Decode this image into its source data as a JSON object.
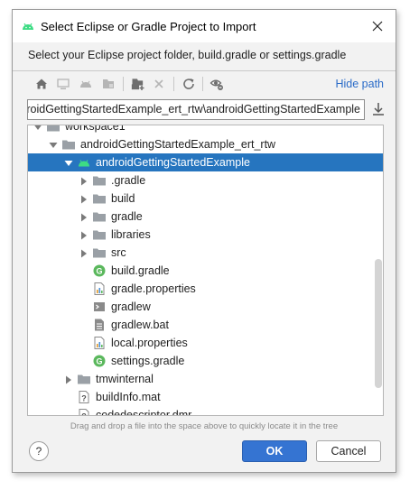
{
  "window": {
    "title": "Select Eclipse or Gradle Project to Import",
    "subtitle": "Select your Eclipse project folder, build.gradle or settings.gradle"
  },
  "toolbar": {
    "hide_path_label": "Hide path"
  },
  "path": {
    "value": "ndroidGettingStartedExample_ert_rtw\\androidGettingStartedExample"
  },
  "tree": {
    "rows": [
      {
        "label": "workspace1",
        "icon": "folder-icon",
        "expanded": true
      },
      {
        "label": "androidGettingStartedExample_ert_rtw",
        "icon": "folder-icon",
        "expanded": true
      },
      {
        "label": "androidGettingStartedExample",
        "icon": "android-icon",
        "expanded": true,
        "selected": true
      },
      {
        "label": ".gradle",
        "icon": "folder-icon",
        "expanded": false
      },
      {
        "label": "build",
        "icon": "folder-icon",
        "expanded": false
      },
      {
        "label": "gradle",
        "icon": "folder-icon",
        "expanded": false
      },
      {
        "label": "libraries",
        "icon": "folder-icon",
        "expanded": false
      },
      {
        "label": "src",
        "icon": "folder-icon",
        "expanded": false
      },
      {
        "label": "build.gradle",
        "icon": "gradle-file-icon"
      },
      {
        "label": "gradle.properties",
        "icon": "properties-file-icon"
      },
      {
        "label": "gradlew",
        "icon": "shell-file-icon"
      },
      {
        "label": "gradlew.bat",
        "icon": "text-file-icon"
      },
      {
        "label": "local.properties",
        "icon": "properties-file-icon"
      },
      {
        "label": "settings.gradle",
        "icon": "gradle-file-icon"
      },
      {
        "label": "tmwinternal",
        "icon": "folder-icon",
        "expanded": false
      },
      {
        "label": "buildInfo.mat",
        "icon": "unknown-file-icon"
      },
      {
        "label": "codedescriptor.dmr",
        "icon": "unknown-file-icon"
      }
    ]
  },
  "hint": "Drag and drop a file into the space above to quickly locate it in the tree",
  "buttons": {
    "help": "?",
    "ok": "OK",
    "cancel": "Cancel"
  },
  "colors": {
    "selection": "#2675bf",
    "link": "#2a6bc8",
    "ok_button": "#3574d2",
    "android_green": "#3ddc84",
    "gradle_green": "#5bb85d"
  }
}
